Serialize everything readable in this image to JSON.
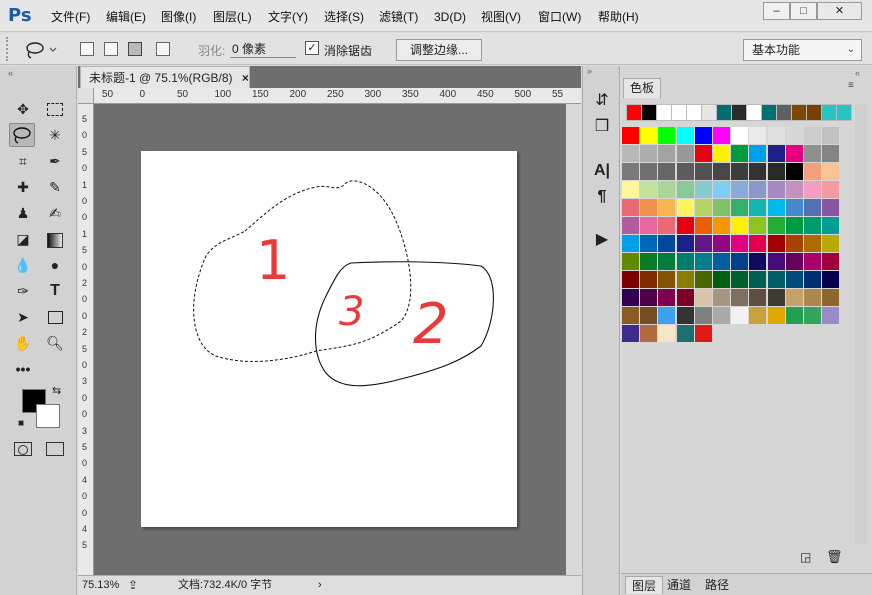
{
  "app": {
    "logo": "Ps"
  },
  "menu": [
    "文件(F)",
    "编辑(E)",
    "图像(I)",
    "图层(L)",
    "文字(Y)",
    "选择(S)",
    "滤镜(T)",
    "3D(D)",
    "视图(V)",
    "窗口(W)",
    "帮助(H)"
  ],
  "window_controls": {
    "minimize": "–",
    "maximize": "□",
    "close": "✕"
  },
  "options": {
    "feather_label": "羽化:",
    "feather_value": "0 像素",
    "antialias_checked": true,
    "antialias_label": "消除锯齿",
    "refine_edge": "调整边缘...",
    "workspace": "基本功能"
  },
  "document": {
    "tab_title": "未标题-1 @ 75.1%(RGB/8)",
    "tab_close": "×",
    "zoom": "75.13%",
    "doc_info": "文档:732.4K/0 字节",
    "ruler_h": [
      "50",
      "0",
      "50",
      "100",
      "150",
      "200",
      "250",
      "300",
      "350",
      "400",
      "450",
      "500",
      "55"
    ],
    "ruler_v": [
      "5",
      "0",
      "5",
      "0",
      "1",
      "0",
      "0",
      "1",
      "5",
      "0",
      "2",
      "0",
      "0",
      "2",
      "5",
      "0",
      "3",
      "0",
      "0",
      "3",
      "5",
      "0",
      "4",
      "0",
      "0",
      "4",
      "5"
    ],
    "canvas_digits": [
      "1",
      "2",
      "3"
    ]
  },
  "swatches": {
    "tab": "色板",
    "recent": [
      "#ff0000",
      "#000000",
      "#ffffff",
      "#ffffff",
      "#ffffff",
      "#e6e6e6",
      "#006e6e",
      "#2b2b2b",
      "#ffffff",
      "#007070",
      "#606060",
      "#7a4a00",
      "#7a3f00",
      "#27c4c4",
      "#27c4c4"
    ],
    "grid": [
      [
        "#ff0000",
        "#ffff00",
        "#00ff00",
        "#00ffff",
        "#0000ff",
        "#ff00ff",
        "#ffffff",
        "#ebebeb",
        "#e0e0e0",
        "#d6d6d6",
        "#cccccc",
        "#c2c2c2"
      ],
      [
        "#b8b8b8",
        "#adadad",
        "#a3a3a3",
        "#999999",
        "#e60012",
        "#fff100",
        "#009944",
        "#00a0e9",
        "#1d2088",
        "#e4007f",
        "#8f8f8f",
        "#848484"
      ],
      [
        "#7a7a7a",
        "#707070",
        "#666666",
        "#5c5c5c",
        "#525252",
        "#474747",
        "#3d3d3d",
        "#333333",
        "#292929",
        "#000000",
        "#f2a07c",
        "#f9c392"
      ],
      [
        "#fff799",
        "#c5e19e",
        "#acd598",
        "#89c997",
        "#84ccc9",
        "#7ecef4",
        "#88abda",
        "#8c97cb",
        "#a48ac0",
        "#c490bf",
        "#f19ec2",
        "#f29c9f"
      ],
      [
        "#eb6877",
        "#f19149",
        "#f8b551",
        "#fff45c",
        "#b3d465",
        "#80c269",
        "#32b16c",
        "#13b5b1",
        "#00b7ee",
        "#448aca",
        "#556fb5",
        "#8957a1"
      ],
      [
        "#ae5da1",
        "#ea68a2",
        "#eb6877",
        "#e60012",
        "#eb6100",
        "#f39800",
        "#fff100",
        "#8fc31f",
        "#22ac38",
        "#009944",
        "#009b6b",
        "#009e96"
      ],
      [
        "#00a0e9",
        "#0068b7",
        "#00479d",
        "#1d2088",
        "#601986",
        "#920783",
        "#e4007f",
        "#e5004f",
        "#a40000",
        "#a84200",
        "#ac6a00",
        "#b7aa00"
      ],
      [
        "#628a00",
        "#097c25",
        "#007c3c",
        "#007e6b",
        "#007f8b",
        "#005f9f",
        "#00418c",
        "#100964",
        "#480a76",
        "#68005a",
        "#aa006a",
        "#a2003c"
      ],
      [
        "#7d0000",
        "#7f2d00",
        "#825300",
        "#877e00",
        "#496601",
        "#005e15",
        "#005f2e",
        "#005e51",
        "#005e69",
        "#004a79",
        "#002e73",
        "#03014d"
      ],
      [
        "#32004f",
        "#4e0048",
        "#7e004f",
        "#7f0027",
        "#d7c4a9",
        "#a89685",
        "#7f6f60",
        "#5e4e42",
        "#3f3a33",
        "#c7a16a",
        "#ad8752",
        "#8e672f"
      ],
      [
        "#8c5a24",
        "#754c24",
        "#3fa0f0",
        "#333333",
        "#808080",
        "#aaaaaa",
        "#f2f2f2",
        "#c8a03c",
        "#e0a800",
        "#20a050",
        "#34a35e",
        "#9b8ac8"
      ],
      [
        "#3f2c8c",
        "#b46a3c",
        "#f5e6c8",
        "#1e6e6e",
        "#e01a1a"
      ]
    ],
    "bottom_tabs": [
      "图层",
      "通道",
      "路径"
    ]
  }
}
